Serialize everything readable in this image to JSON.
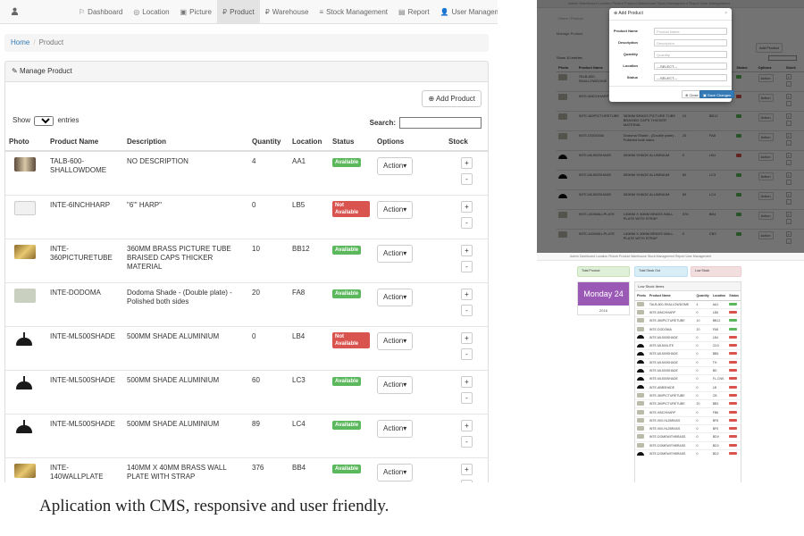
{
  "nav": {
    "items": [
      {
        "icon": "dashboard-icon",
        "glyph": "⚐",
        "label": "Dashboard"
      },
      {
        "icon": "location-icon",
        "glyph": "◎",
        "label": "Location"
      },
      {
        "icon": "picture-icon",
        "glyph": "▣",
        "label": "Picture"
      },
      {
        "icon": "product-icon",
        "glyph": "₽",
        "label": "Product",
        "active": true
      },
      {
        "icon": "warehouse-icon",
        "glyph": "₽",
        "label": "Warehouse"
      },
      {
        "icon": "stock-icon",
        "glyph": "≡",
        "label": "Stock Management"
      },
      {
        "icon": "report-icon",
        "glyph": "▤",
        "label": "Report"
      },
      {
        "icon": "user-management-icon",
        "glyph": "👤",
        "label": "User Management"
      }
    ],
    "user_caret": "▾"
  },
  "breadcrumb": {
    "home": "Home",
    "sep": "/",
    "current": "Product"
  },
  "panel": {
    "title": "Manage Product",
    "add_button": "Add Product"
  },
  "table_controls": {
    "show_prefix": "Show",
    "show_value": "10",
    "show_suffix": "entries",
    "search_label": "Search:"
  },
  "columns": [
    "Photo",
    "Product Name",
    "Description",
    "Quantity",
    "Location",
    "Status",
    "Options",
    "Stock"
  ],
  "rows": [
    {
      "thumb": "dark",
      "name": "TALB-600-SHALLOWDOME",
      "description": "NO DESCRIPTION",
      "quantity": "4",
      "location": "AA1",
      "status": "Available",
      "ok": true
    },
    {
      "thumb": "harp",
      "name": "INTE-6INCHHARP",
      "description": "\"6\"' HARP\"",
      "quantity": "0",
      "location": "LB5",
      "status": "Not Available",
      "ok": false
    },
    {
      "thumb": "brass",
      "name": "INTE-360PICTURETUBE",
      "description": "360MM BRASS PICTURE TUBE BRAISED CAPS THICKER MATERIAL",
      "quantity": "10",
      "location": "BB12",
      "status": "Available",
      "ok": true
    },
    {
      "thumb": "dodo",
      "name": "INTE-DODOMA",
      "description": "Dodoma Shade - (Double plate) - Polished both sides",
      "quantity": "20",
      "location": "FA8",
      "status": "Available",
      "ok": true
    },
    {
      "thumb": "shade",
      "name": "INTE-ML500SHADE",
      "description": "500MM SHADE ALUMINIUM",
      "quantity": "0",
      "location": "LB4",
      "status": "Not Available",
      "ok": false
    },
    {
      "thumb": "shade",
      "name": "INTE-ML500SHADE",
      "description": "500MM SHADE ALUMINIUM",
      "quantity": "60",
      "location": "LC3",
      "status": "Available",
      "ok": true
    },
    {
      "thumb": "shade",
      "name": "INTE-ML500SHADE",
      "description": "500MM SHADE ALUMINIUM",
      "quantity": "89",
      "location": "LC4",
      "status": "Available",
      "ok": true
    },
    {
      "thumb": "brass",
      "name": "INTE-140WALLPLATE",
      "description": "140MM X 40MM BRASS WALL PLATE WITH STRAP",
      "quantity": "376",
      "location": "BB4",
      "status": "Available",
      "ok": true
    }
  ],
  "action_label": "Action",
  "stock_plus": "+",
  "stock_minus": "-",
  "caption": "Aplication with CMS, responsive and user friendly.",
  "modal_shot": {
    "nav_text": "Admin   Dashboard   Location   Picture   Product   Warehouse   Stock Management   Report   User Management",
    "crumb": "Home / Product",
    "panel_title": "Manage Product",
    "add_button": "Add Product",
    "show_text": "Show 10 entries",
    "columns": [
      "Photo",
      "Product Name",
      "Description",
      "Quantity",
      "Location",
      "Status",
      "Options",
      "Stock"
    ],
    "rows": [
      {
        "thumb": "dark",
        "name": "TALB-600-SHALLOWDOME",
        "description": "NO DESCRIPTION",
        "quantity": "4",
        "location": "AA1",
        "ok": true
      },
      {
        "thumb": "harp",
        "name": "INTE-6INCHHARP",
        "description": "\"6\" HARP",
        "quantity": "0",
        "location": "LB5",
        "ok": false
      },
      {
        "thumb": "brass",
        "name": "INTE-360PICTURETUBE",
        "description": "360MM BRASS PICTURE TUBE BRAISED CAPS THICKER MATERIAL",
        "quantity": "10",
        "location": "BB12",
        "ok": true
      },
      {
        "thumb": "dodo",
        "name": "INTE-DODOMA",
        "description": "Dodoma Shade - (Double plate) - Polished both sides",
        "quantity": "20",
        "location": "FA8",
        "ok": true
      },
      {
        "thumb": "shade",
        "name": "INTE-ML500SHADE",
        "description": "500MM SHADE ALUMINIUM",
        "quantity": "0",
        "location": "LB4",
        "ok": false
      },
      {
        "thumb": "shade",
        "name": "INTE-ML500SHADE",
        "description": "500MM SHADE ALUMINIUM",
        "quantity": "60",
        "location": "LC3",
        "ok": true
      },
      {
        "thumb": "shade",
        "name": "INTE-ML500SHADE",
        "description": "500MM SHADE ALUMINIUM",
        "quantity": "89",
        "location": "LC4",
        "ok": true
      },
      {
        "thumb": "brass",
        "name": "INTE-140WALLPLATE",
        "description": "140MM X 40MM BRASS WALL PLATE WITH STRAP",
        "quantity": "376",
        "location": "BB4",
        "ok": true
      },
      {
        "thumb": "brass",
        "name": "INTE-140WALLPLATE",
        "description": "140MM X 40MM BRASS WALL PLATE WITH STRAP",
        "quantity": "0",
        "location": "CB3",
        "ok": true
      }
    ],
    "modal": {
      "title": "Add Product",
      "close_x": "×",
      "fields": [
        {
          "label": "Product Name",
          "value": "Product Name",
          "select": false
        },
        {
          "label": "Description",
          "value": "Description",
          "select": false
        },
        {
          "label": "Quantity",
          "value": "Quantity",
          "select": false
        },
        {
          "label": "Location",
          "value": "---SELECT---",
          "select": true
        },
        {
          "label": "Status",
          "value": "---SELECT---",
          "select": true
        }
      ],
      "close_button": "Close",
      "save_button": "Save Changes"
    }
  },
  "dash_shot": {
    "nav_text": "Admin   Dashboard   Location   Picture   Product   Warehouse   Stock Management   Report   User Management",
    "stats": [
      "Total Product",
      "Total Stock Out",
      "Low Stock"
    ],
    "day_label": "Monday 24",
    "day_num": "2016",
    "list_title": "Low Stock Items",
    "columns": [
      "Photo",
      "Product Name",
      "Quantity",
      "Location",
      "Status"
    ],
    "rows": [
      {
        "thumb": "dark",
        "name": "TALB-600-SHALLOWDOME",
        "q": "4",
        "loc": "AA1",
        "ok": true
      },
      {
        "thumb": "harp",
        "name": "INTE-6INCHHARP",
        "q": "0",
        "loc": "LB5",
        "ok": false
      },
      {
        "thumb": "brass",
        "name": "INTE-360PICTURETUBE",
        "q": "10",
        "loc": "BB12",
        "ok": true
      },
      {
        "thumb": "dodo",
        "name": "INTE-DODOMA",
        "q": "20",
        "loc": "FA8",
        "ok": true
      },
      {
        "thumb": "shade",
        "name": "INTE-ML500SHADE",
        "q": "0",
        "loc": "LB4",
        "ok": false
      },
      {
        "thumb": "shade",
        "name": "INTE-ML500LITE",
        "q": "0",
        "loc": "CD3",
        "ok": false
      },
      {
        "thumb": "shade",
        "name": "INTE-ML500SHADE",
        "q": "0",
        "loc": "BB5",
        "ok": false
      },
      {
        "thumb": "shade",
        "name": "INTE-ML500SHADE",
        "q": "0",
        "loc": "TH",
        "ok": false
      },
      {
        "thumb": "shade",
        "name": "INTE-ML500SHADE",
        "q": "0",
        "loc": "BD",
        "ok": false
      },
      {
        "thumb": "shade",
        "name": "INTE-ML500SHADE",
        "q": "0",
        "loc": "FL-CNS",
        "ok": false
      },
      {
        "thumb": "shade",
        "name": "INTE-ABBSHADE",
        "q": "0",
        "loc": "LB",
        "ok": false
      },
      {
        "thumb": "brass",
        "name": "INTE-360PICTURETUBE",
        "q": "0",
        "loc": "CB",
        "ok": false
      },
      {
        "thumb": "brass",
        "name": "INTE-360PICTURETUBE",
        "q": "20",
        "loc": "BB3",
        "ok": false
      },
      {
        "thumb": "harp",
        "name": "INTE-9INCHHARP",
        "q": "0",
        "loc": "FB6",
        "ok": false
      },
      {
        "thumb": "brass",
        "name": "INTE-900-HL2BRASS",
        "q": "0",
        "loc": "BF8",
        "ok": false
      },
      {
        "thumb": "brass",
        "name": "INTE-900-HL2BRASS",
        "q": "0",
        "loc": "BF5",
        "ok": false
      },
      {
        "thumb": "brass",
        "name": "INTE-DOMEWITHBRASS",
        "q": "0",
        "loc": "BD9",
        "ok": false
      },
      {
        "thumb": "brass",
        "name": "INTE-DOMEWITHBRASS",
        "q": "0",
        "loc": "BD3",
        "ok": false
      },
      {
        "thumb": "shade",
        "name": "INTE-DOMEWITHBRASS",
        "q": "0",
        "loc": "BD2",
        "ok": false
      }
    ]
  }
}
